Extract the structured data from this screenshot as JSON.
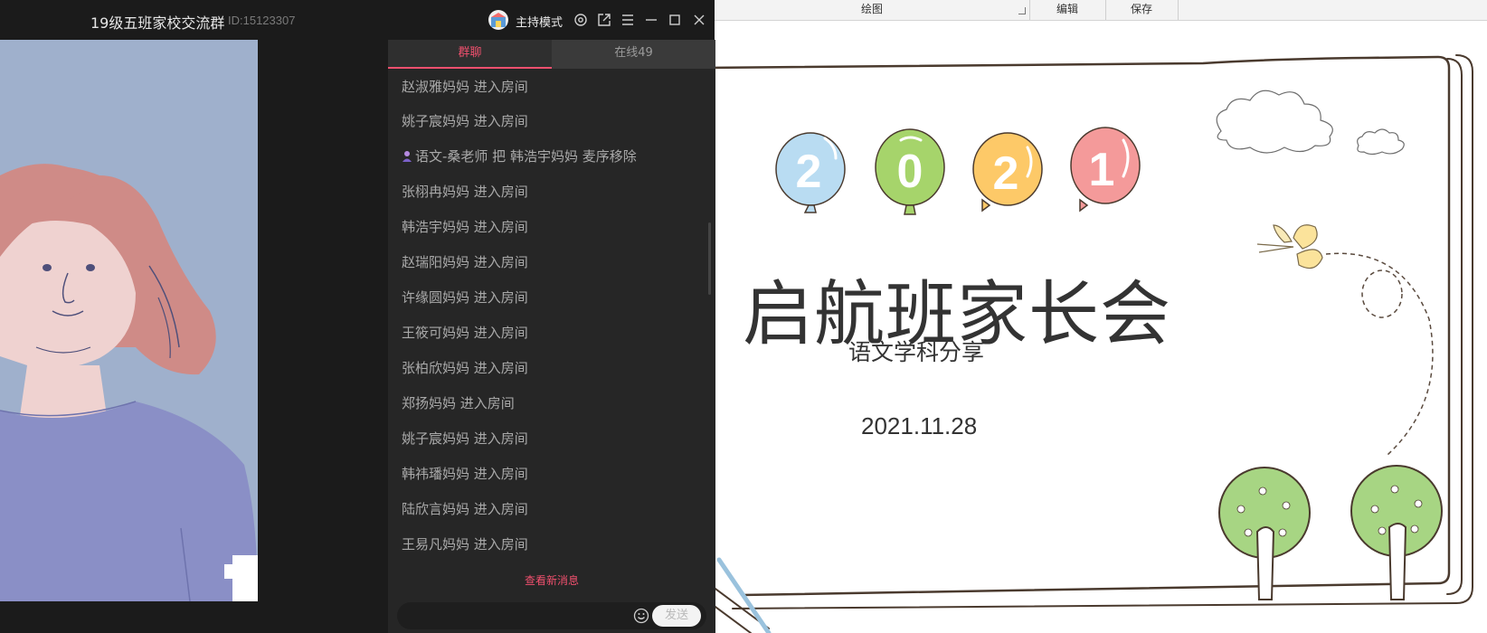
{
  "window": {
    "title": "19级五班家校交流群",
    "id_label": "ID:15123307",
    "host_mode_label": "主持模式"
  },
  "chat": {
    "tabs": [
      {
        "label": "群聊",
        "active": true
      },
      {
        "label": "在线49",
        "active": false
      }
    ],
    "messages": [
      {
        "text": "赵淑雅妈妈 进入房间"
      },
      {
        "text": "姚子宸妈妈 进入房间"
      },
      {
        "text": "语文-桑老师 把 韩浩宇妈妈 麦序移除",
        "icon": "teacher-icon"
      },
      {
        "text": "张栩冉妈妈 进入房间"
      },
      {
        "text": "韩浩宇妈妈 进入房间"
      },
      {
        "text": "赵瑞阳妈妈 进入房间"
      },
      {
        "text": "许缘圆妈妈 进入房间"
      },
      {
        "text": "王筱可妈妈 进入房间"
      },
      {
        "text": "张柏欣妈妈 进入房间"
      },
      {
        "text": "郑扬妈妈 进入房间"
      },
      {
        "text": "姚子宸妈妈 进入房间"
      },
      {
        "text": "韩祎璠妈妈 进入房间"
      },
      {
        "text": "陆欣言妈妈 进入房间"
      },
      {
        "text": "王易凡妈妈 进入房间"
      }
    ],
    "view_new_label": "查看新消息",
    "input_placeholder": "",
    "send_label": "发送",
    "accent_color": "#f0506e"
  },
  "ribbon": {
    "groups": [
      "绘图",
      "编辑",
      "保存"
    ]
  },
  "slide": {
    "balloon_digits": [
      "2",
      "0",
      "2",
      "1"
    ],
    "balloon_colors": [
      "#b9dcf2",
      "#a6d46b",
      "#fdc968",
      "#f49a9a"
    ],
    "title": "启航班家长会",
    "subtitle": "语文学科分享",
    "date": "2021.11.28"
  }
}
